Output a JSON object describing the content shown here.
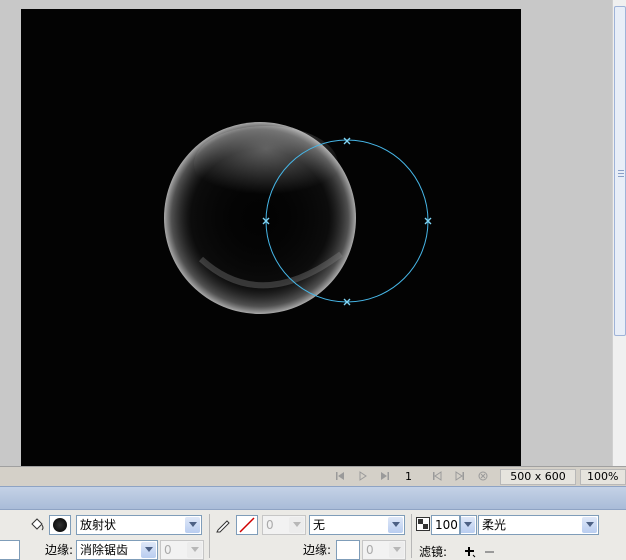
{
  "status_bar": {
    "frame_number": "1",
    "stage_size": "500 x 600",
    "zoom": "100%"
  },
  "properties": {
    "fill_type": "放射状",
    "stroke_width": "0",
    "stroke_texture": "无",
    "opacity": "100",
    "blend_mode": "柔光",
    "edge_label": "边缘:",
    "edge_value": "消除锯齿",
    "edge_amount": "0",
    "stroke_edge_label": "边缘:",
    "stroke_edge_amount": "0",
    "filters_label": "滤镜:"
  },
  "colors": {
    "stage": "#030303",
    "path_selection": "#47b7e8",
    "panel_header": "#b5c6e0",
    "stroke_none": "#d00000"
  },
  "icons": {
    "frame_controls": [
      "first-frame-icon",
      "play-icon",
      "last-frame-icon",
      "prev-frame-icon",
      "next-frame-icon",
      "stop-icon"
    ],
    "fill_tool": "paint-bucket-icon",
    "stroke_tool": "pencil-icon",
    "filter_add": "plus-icon",
    "filter_remove": "minus-icon"
  }
}
